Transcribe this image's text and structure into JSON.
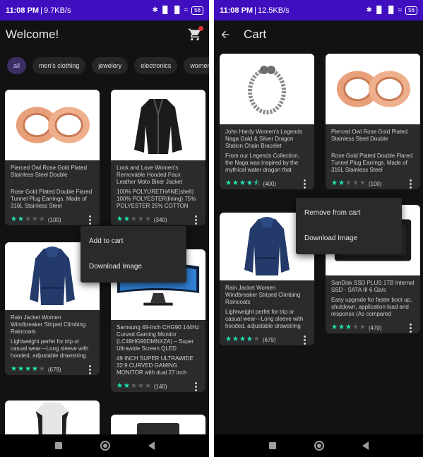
{
  "status_left": {
    "time": "11:08 PM",
    "speed": "9.7KB/s"
  },
  "status_right": {
    "time": "11:08 PM",
    "speed": "12.5KB/s"
  },
  "status_icons": "✱ ▐▌ ▐▌ ≈",
  "battery": "56",
  "home": {
    "title": "Welcome!",
    "chips": [
      "all",
      "men's clothing",
      "jewelery",
      "electronics",
      "women's clothing"
    ],
    "products": [
      {
        "name": "Pierced Owl Rose Gold Plated Stainless Steel Double",
        "desc": "Rose Gold Plated Double Flared Tunnel Plug Earrings. Made of 316L Stainless Steel",
        "count": "(100)",
        "rating": 2,
        "image_icon": "rose-gold-plugs"
      },
      {
        "name": "Lock and Love Women's Removable Hooded Faux Leather Moto Biker Jacket",
        "desc": "100% POLYURETHANE(shell) 100% POLYESTER(lining) 75% POLYESTER 25% COTTON",
        "count": "(340)",
        "rating": 2,
        "image_icon": "leather-jacket"
      },
      {
        "name": "Rain Jacket Women Windbreaker Striped Climbing Raincoats",
        "desc": "Lightweight perfet for trip or casual wear---Long sleeve with hooded, adjustable drawstring",
        "count": "(679)",
        "rating": 4,
        "image_icon": "rain-jacket"
      },
      {
        "name": "Samsung 49-Inch CHG90 144Hz Curved Gaming Monitor (LC49HG90DMNXZA) – Super Ultrawide Screen QLED",
        "desc": "49 INCH SUPER ULTRAWIDE 32:9 CURVED GAMING MONITOR with dual 27 inch screen",
        "count": "(140)",
        "rating": 2,
        "image_icon": "curved-monitor"
      }
    ],
    "menu": [
      "Add to cart",
      "Download Image"
    ]
  },
  "cart": {
    "title": "Cart",
    "products": [
      {
        "name": "John Hardy Women's Legends Naga Gold & Silver Dragon Station Chain Bracelet",
        "desc": "From our Legends Collection, the Naga was inspired by the mythical water dragon that",
        "count": "(400)",
        "rating": 4.5,
        "image_icon": "dragon-bracelet"
      },
      {
        "name": "Pierced Owl Rose Gold Plated Stainless Steel Double",
        "desc": "Rose Gold Plated Double Flared Tunnel Plug Earrings. Made of 316L Stainless Steel",
        "count": "(100)",
        "rating": 2,
        "image_icon": "rose-gold-plugs"
      },
      {
        "name": "Rain Jacket Women Windbreaker Striped Climbing Raincoats",
        "desc": "Lightweight perfet for trip or casual wear---Long sleeve with hooded, adjustable drawstring",
        "count": "(679)",
        "rating": 4,
        "image_icon": "rain-jacket"
      },
      {
        "name": "SanDisk SSD PLUS 1TB Internal SSD - SATA III 6 Gb/s",
        "desc": "Easy upgrade for faster boot up, shutdown, application load and response (As compared",
        "count": "(470)",
        "rating": 3,
        "image_icon": "sandisk-ssd"
      }
    ],
    "menu": [
      "Remove from cart",
      "Download Image"
    ]
  },
  "colors": {
    "status_bar": "#3f0fbf",
    "background": "#121212",
    "card": "#2b2b2b",
    "star": "#1de9b6",
    "chip_active": "#3a2e63",
    "badge": "#e53935"
  }
}
